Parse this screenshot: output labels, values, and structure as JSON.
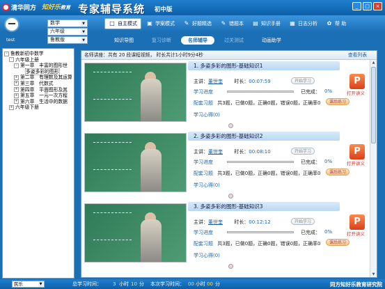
{
  "header": {
    "logo_text": "清华同方",
    "logo2_text": "知好乐",
    "logo2_suffix": "教育",
    "app_title": "专家辅导系统",
    "app_subtitle": "初中版",
    "win_min": "_",
    "win_max": "□",
    "win_close": "×"
  },
  "left": {
    "user_label": "test",
    "subject": "数学",
    "grade": "六年级",
    "publisher": "鲁教版"
  },
  "toolbar": [
    {
      "label": "自主模式",
      "icon": "□",
      "active": true
    },
    {
      "label": "学案模式",
      "icon": "▣",
      "active": false
    },
    {
      "label": "好题精选",
      "icon": "✎",
      "active": false
    },
    {
      "label": "错题本",
      "icon": "✎",
      "active": false
    },
    {
      "label": "知识手册",
      "icon": "▤",
      "active": false
    },
    {
      "label": "日志分析",
      "icon": "▦",
      "active": false
    },
    {
      "label": "帮 助",
      "icon": "✿",
      "active": false
    }
  ],
  "tabs": [
    {
      "label": "知识导图",
      "state": "normal"
    },
    {
      "label": "复习诊断",
      "state": "dim"
    },
    {
      "label": "名师辅导",
      "state": "active"
    },
    {
      "label": "过关测试",
      "state": "dim"
    },
    {
      "label": "动画助学",
      "state": "normal"
    }
  ],
  "tree": [
    {
      "label": "鲁教新初中数学",
      "pm": "-",
      "indent": 0
    },
    {
      "label": "六年级上册",
      "pm": "-",
      "indent": 1
    },
    {
      "label": "第一章　丰富的图形世",
      "pm": "-",
      "indent": 2
    },
    {
      "label": "多姿多彩的图形",
      "pm": "",
      "indent": 3,
      "hl": true
    },
    {
      "label": "第二章　有理数及其运算",
      "pm": "+",
      "indent": 2
    },
    {
      "label": "第三章　代数式",
      "pm": "+",
      "indent": 2
    },
    {
      "label": "第四章　平面图形及其",
      "pm": "+",
      "indent": 2
    },
    {
      "label": "第五章　一元一次方程",
      "pm": "+",
      "indent": 2
    },
    {
      "label": "第六章　生活中的数据",
      "pm": "+",
      "indent": 2
    },
    {
      "label": "六年级下册",
      "pm": "+",
      "indent": 1
    }
  ],
  "main": {
    "header": "名师讲座：共有 20 段课程视频， 时长共计1小时9分4秒",
    "view_list": "查看列表",
    "courses": [
      {
        "title": "1. 多姿多彩的图形-基础知识1",
        "teacher_label": "主讲：",
        "teacher": "董世奎",
        "duration_label": "时长：",
        "duration": "00:07:59",
        "start_btn": "开始学习",
        "progress_label": "学习进度",
        "done_label": "已完成：",
        "done_value": "0%",
        "progress": 0,
        "exercise_label": "配套习题",
        "exercise_stats": "共3题，已做0题，正确0题，错误0题，正确率0",
        "review_btn": "课后练习",
        "notes_label": "学习心得(0)",
        "ppt_label": "打开讲义"
      },
      {
        "title": "2. 多姿多彩的图形-基础知识2",
        "teacher_label": "主讲：",
        "teacher": "董世奎",
        "duration_label": "时长：",
        "duration": "00:08:10",
        "start_btn": "开始学习",
        "progress_label": "学习进度",
        "done_label": "已完成：",
        "done_value": "0%",
        "progress": 0,
        "exercise_label": "配套习题",
        "exercise_stats": "共3题，已做0题，正确0题，错误0题，正确率0",
        "review_btn": "课后练习",
        "notes_label": "学习心得(0)",
        "ppt_label": "打开讲义"
      },
      {
        "title": "3. 多姿多彩的图形-基础知识3",
        "teacher_label": "主讲：",
        "teacher": "董世奎",
        "duration_label": "时长：",
        "duration": "00:12:12",
        "start_btn": "开始学习",
        "progress_label": "学习进度",
        "done_label": "已完成：",
        "done_value": "0%",
        "progress": 0,
        "exercise_label": "配套习题",
        "exercise_stats": "共3题，已做0题，正确0题，错误0题，正确率0",
        "review_btn": "课后练习",
        "notes_label": "学习心得(0)",
        "ppt_label": "打开讲义"
      }
    ]
  },
  "status": {
    "select_value": "民乐",
    "total_label": "总学习时间：",
    "total_h": "3",
    "hour_unit": "小时",
    "total_m": "10",
    "min_unit": "分",
    "session_label": "本次学习时间：",
    "session_h": "00",
    "session_m": "00",
    "brand": "同方知好乐教育研究院"
  }
}
